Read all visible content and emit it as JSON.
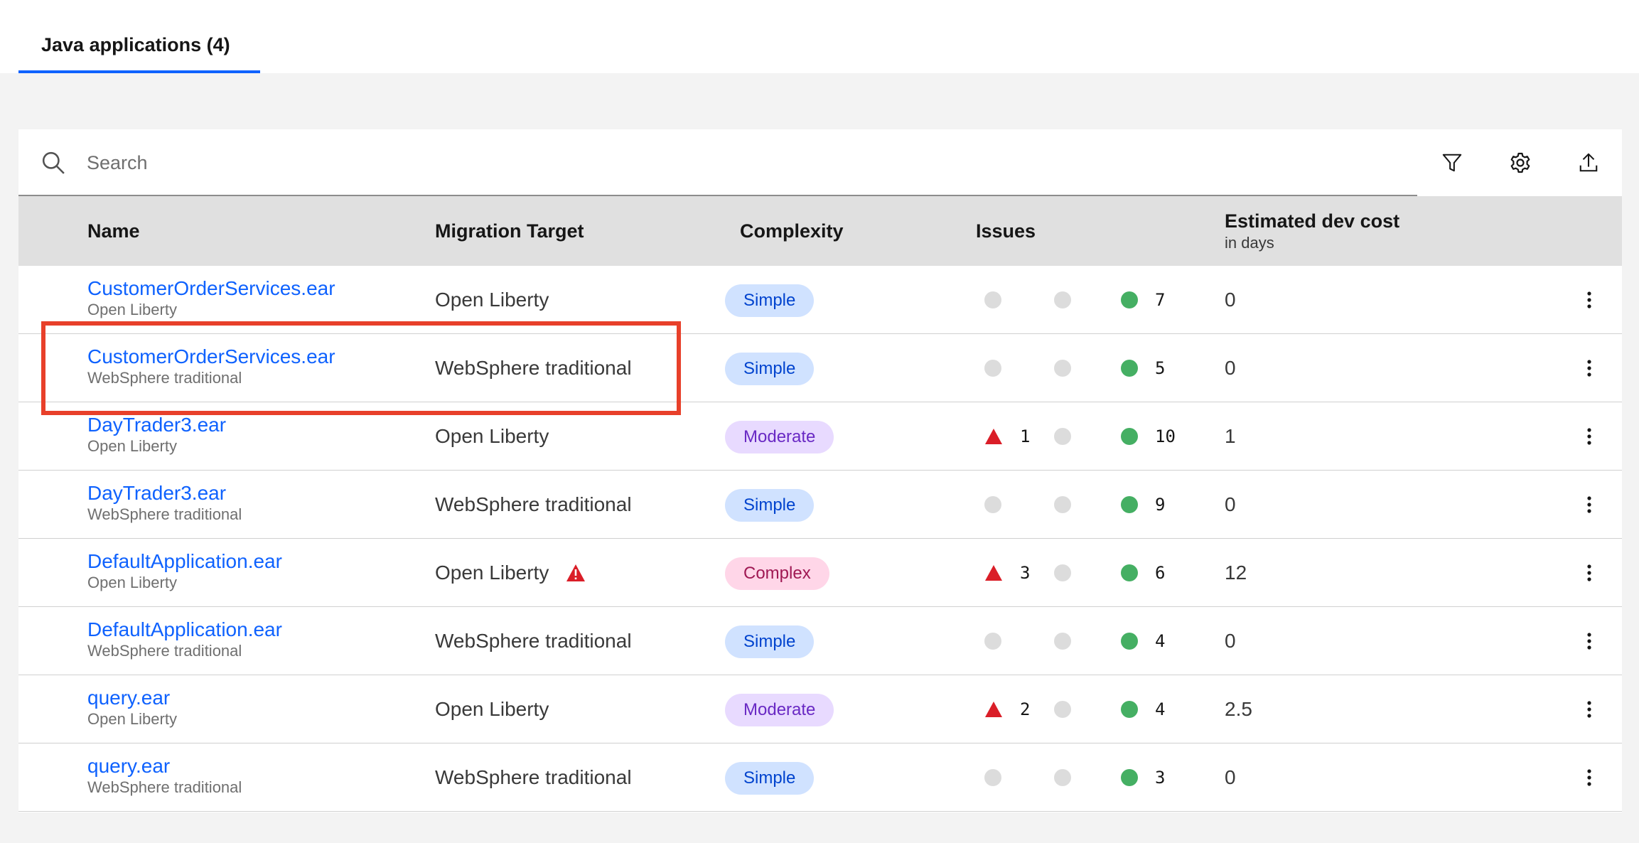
{
  "tabs": [
    {
      "label": "Java applications (4)"
    }
  ],
  "search": {
    "placeholder": "Search"
  },
  "toolbar": {
    "icons": [
      "filter-icon",
      "settings-icon",
      "export-icon"
    ]
  },
  "table": {
    "headers": {
      "name": "Name",
      "target": "Migration Target",
      "complexity": "Complexity",
      "issues": "Issues",
      "cost": "Estimated dev cost",
      "cost_sub": "in days"
    },
    "rows": [
      {
        "name": "CustomerOrderServices.ear",
        "sub": "Open Liberty",
        "target": "Open Liberty",
        "complexity": "Simple",
        "critical": "",
        "warning": "",
        "info": "7",
        "cost": "0"
      },
      {
        "name": "CustomerOrderServices.ear",
        "sub": "WebSphere traditional",
        "target": "WebSphere traditional",
        "complexity": "Simple",
        "critical": "",
        "warning": "",
        "info": "5",
        "cost": "0"
      },
      {
        "name": "DayTrader3.ear",
        "sub": "Open Liberty",
        "target": "Open Liberty",
        "complexity": "Moderate",
        "critical": "1",
        "warning": "",
        "info": "10",
        "cost": "1"
      },
      {
        "name": "DayTrader3.ear",
        "sub": "WebSphere traditional",
        "target": "WebSphere traditional",
        "complexity": "Simple",
        "critical": "",
        "warning": "",
        "info": "9",
        "cost": "0"
      },
      {
        "name": "DefaultApplication.ear",
        "sub": "Open Liberty",
        "target": "Open Liberty",
        "complexity": "Complex",
        "critical": "3",
        "warning": "",
        "info": "6",
        "cost": "12"
      },
      {
        "name": "DefaultApplication.ear",
        "sub": "WebSphere traditional",
        "target": "WebSphere traditional",
        "complexity": "Simple",
        "critical": "",
        "warning": "",
        "info": "4",
        "cost": "0"
      },
      {
        "name": "query.ear",
        "sub": "Open Liberty",
        "target": "Open Liberty",
        "complexity": "Moderate",
        "critical": "2",
        "warning": "",
        "info": "4",
        "cost": "2.5"
      },
      {
        "name": "query.ear",
        "sub": "WebSphere traditional",
        "target": "WebSphere traditional",
        "complexity": "Simple",
        "critical": "",
        "warning": "",
        "info": "3",
        "cost": "0"
      }
    ]
  },
  "colors": {
    "accent": "#0f62fe",
    "critical": "#da1e28",
    "success": "#24a148",
    "highlight": "#e8402a"
  }
}
